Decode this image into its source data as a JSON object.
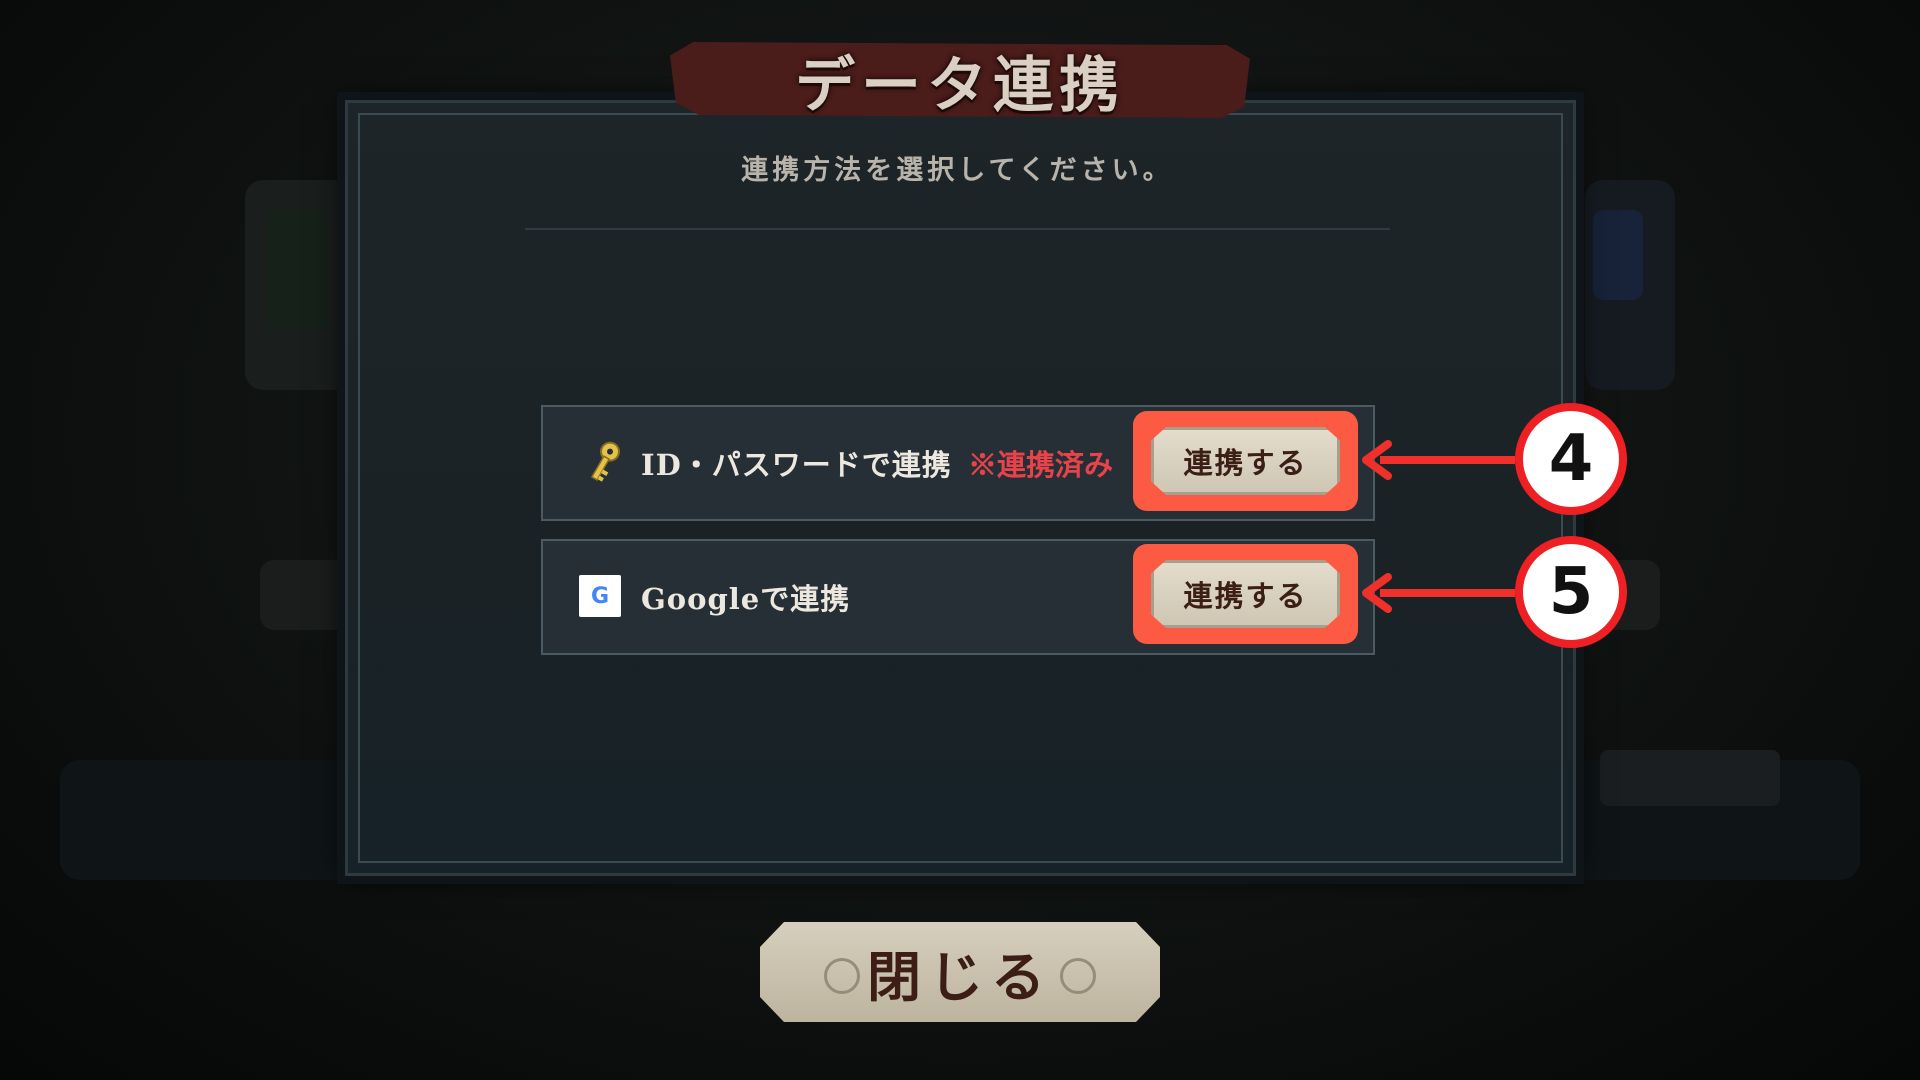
{
  "dialog": {
    "title": "データ連携",
    "subtitle": "連携方法を選択してください。"
  },
  "options": [
    {
      "icon": "key-icon",
      "label": "ID・パスワードで連携",
      "status": "※連携済み",
      "button_label": "連携する"
    },
    {
      "icon": "google-icon",
      "icon_glyph": "G",
      "label": "Googleで連携",
      "button_label": "連携する"
    }
  ],
  "callouts": [
    {
      "number": "4"
    },
    {
      "number": "5"
    }
  ],
  "close_button_label": "閉じる",
  "colors": {
    "highlight": "#fd5a43",
    "callout_red": "#ee2024",
    "status_red": "#e8424a",
    "title_banner": "#4a1c1a",
    "key_gold": "#e2c24a"
  }
}
